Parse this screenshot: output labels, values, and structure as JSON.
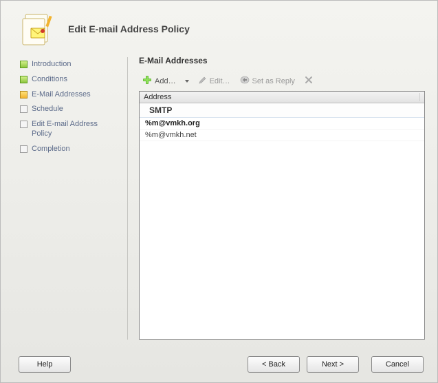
{
  "header": {
    "title": "Edit E-mail Address Policy"
  },
  "steps": [
    {
      "label": "Introduction",
      "state": "done"
    },
    {
      "label": "Conditions",
      "state": "done"
    },
    {
      "label": "E-Mail Addresses",
      "state": "current"
    },
    {
      "label": "Schedule",
      "state": "pending"
    },
    {
      "label": "Edit E-mail Address Policy",
      "state": "pending"
    },
    {
      "label": "Completion",
      "state": "pending"
    }
  ],
  "content": {
    "section_title": "E-Mail Addresses",
    "toolbar": {
      "add": "Add…",
      "edit": "Edit…",
      "set_as_reply": "Set as Reply"
    },
    "list": {
      "column_header": "Address",
      "group": "SMTP",
      "addresses": [
        {
          "value": "%m@vmkh.org",
          "primary": true
        },
        {
          "value": "%m@vmkh.net",
          "primary": false
        }
      ]
    }
  },
  "footer": {
    "help": "Help",
    "back": "< Back",
    "next": "Next >",
    "cancel": "Cancel"
  }
}
